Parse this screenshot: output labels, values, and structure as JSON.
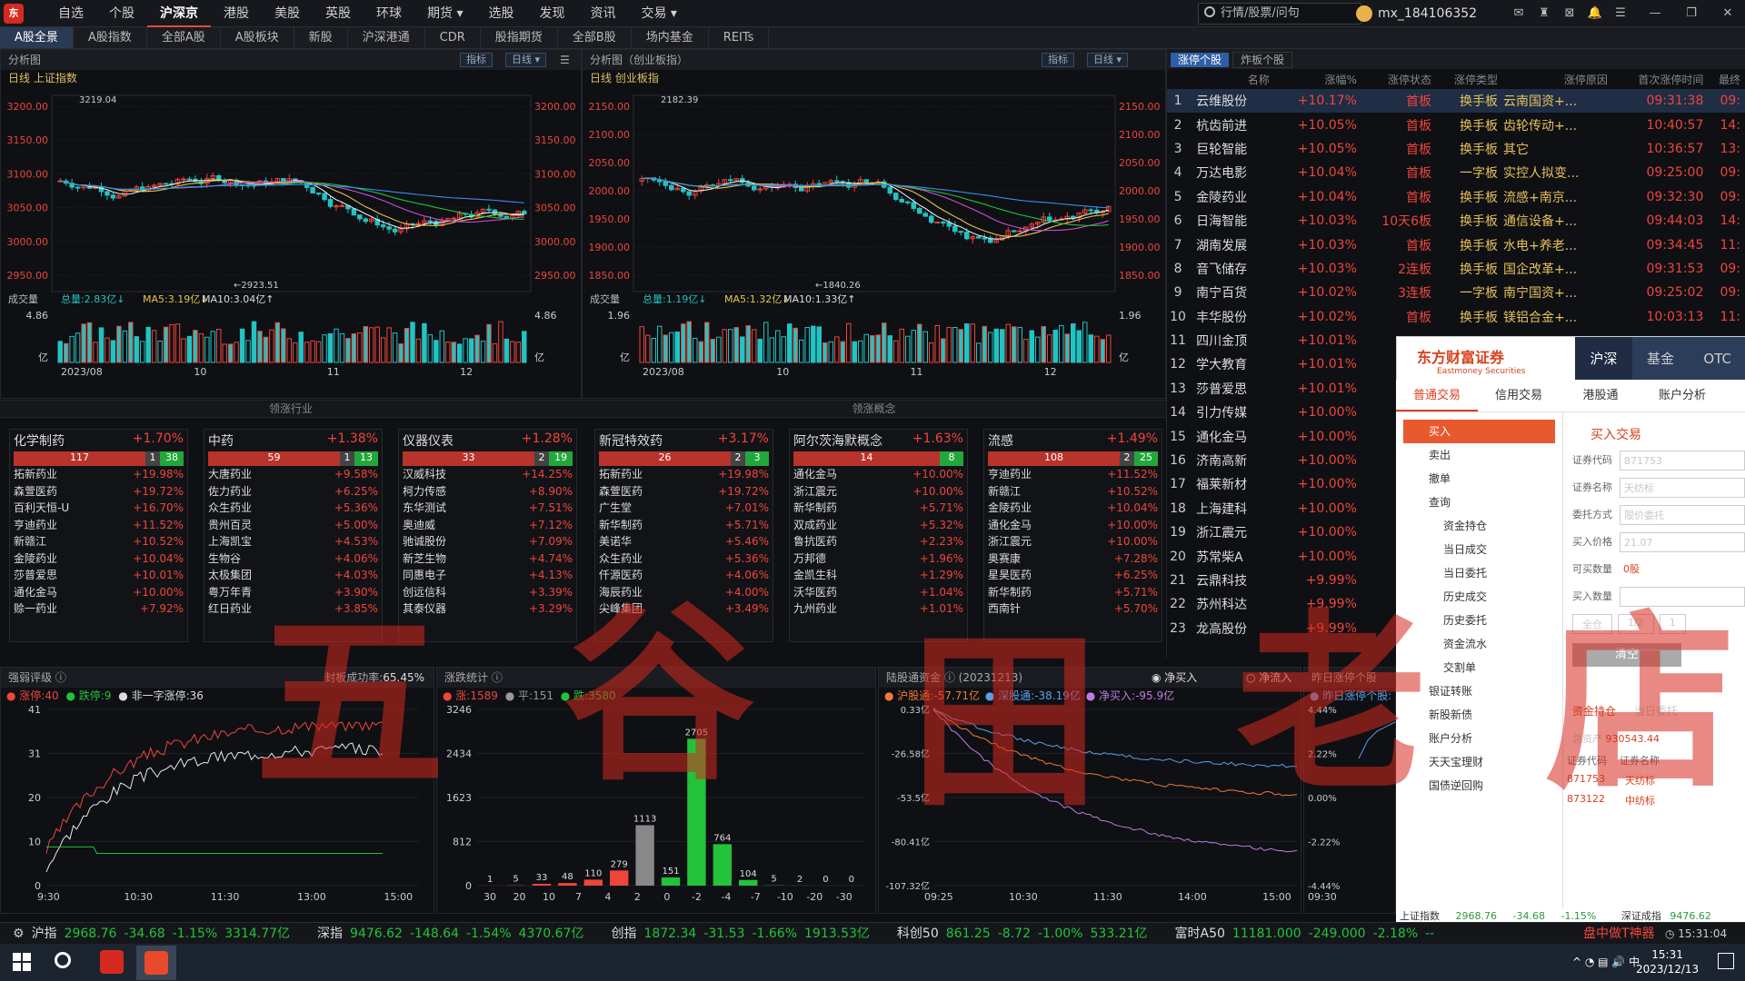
{
  "topnav": [
    "自选",
    "个股",
    "沪深京",
    "港股",
    "美股",
    "英股",
    "环球",
    "期货 ▾",
    "选股",
    "发现",
    "资讯",
    "交易 ▾"
  ],
  "search_placeholder": "行情/股票/问句",
  "user": "mx_184106352",
  "subtabs": [
    "A股全景",
    "A股指数",
    "全部A股",
    "A股板块",
    "新股",
    "沪深港通",
    "CDR",
    "股指期货",
    "全部B股",
    "场内基金",
    "REITs"
  ],
  "chart1": {
    "panel": "分析图",
    "sub": "日线  上证指数",
    "btn1": "指标",
    "btn2": "日线",
    "high": "3219.04",
    "low": "2923.51",
    "yticks": [
      "3200.00",
      "3150.00",
      "3100.00",
      "3050.00",
      "3000.00",
      "2950.00"
    ],
    "vol_label": "成交量",
    "vol_total": "总量:2.83亿",
    "vol_ma5": "MA5:3.19亿",
    "vol_ma10": "MA10:3.04亿",
    "vol_max": "4.86",
    "vol_unit": "亿",
    "xticks": [
      "2023/08",
      "10",
      "11",
      "12"
    ]
  },
  "chart2": {
    "panel": "分析图（创业板指）",
    "sub": "日线  创业板指",
    "btn1": "指标",
    "btn2": "日线",
    "high": "2182.39",
    "low": "1840.26",
    "yticks": [
      "2150.00",
      "2100.00",
      "2050.00",
      "2000.00",
      "1950.00",
      "1900.00",
      "1850.00"
    ],
    "vol_label": "成交量",
    "vol_total": "总量:1.19亿",
    "vol_ma5": "MA5:1.32亿",
    "vol_ma10": "MA10:1.33亿",
    "vol_max": "1.96",
    "vol_unit": "亿",
    "xticks": [
      "2023/08",
      "10",
      "11",
      "12"
    ]
  },
  "sec1_title": "领涨行业",
  "sec2_title": "领涨概念",
  "sectors": [
    {
      "name": "化学制药",
      "pct": "+1.70%",
      "up": "117",
      "flat": "1",
      "down": "38",
      "rows": [
        [
          "拓新药业",
          "+19.98%"
        ],
        [
          "森萱医药",
          "+19.72%"
        ],
        [
          "百利天恒-U",
          "+16.70%"
        ],
        [
          "亨迪药业",
          "+11.52%"
        ],
        [
          "新赣江",
          "+10.52%"
        ],
        [
          "金陵药业",
          "+10.04%"
        ],
        [
          "莎普爱思",
          "+10.01%"
        ],
        [
          "通化金马",
          "+10.00%"
        ],
        [
          "赊一药业",
          "+7.92%"
        ]
      ]
    },
    {
      "name": "中药",
      "pct": "+1.38%",
      "up": "59",
      "flat": "1",
      "down": "13",
      "rows": [
        [
          "大唐药业",
          "+9.58%"
        ],
        [
          "佐力药业",
          "+6.25%"
        ],
        [
          "众生药业",
          "+5.36%"
        ],
        [
          "贵州百灵",
          "+5.00%"
        ],
        [
          "上海凯宝",
          "+4.53%"
        ],
        [
          "生物谷",
          "+4.06%"
        ],
        [
          "太极集团",
          "+4.03%"
        ],
        [
          "粤万年青",
          "+3.90%"
        ],
        [
          "红日药业",
          "+3.85%"
        ]
      ]
    },
    {
      "name": "仪器仪表",
      "pct": "+1.28%",
      "up": "33",
      "flat": "2",
      "down": "19",
      "rows": [
        [
          "汉威科技",
          "+14.25%"
        ],
        [
          "柯力传感",
          "+8.90%"
        ],
        [
          "东华测试",
          "+7.51%"
        ],
        [
          "奥迪威",
          "+7.12%"
        ],
        [
          "驰诚股份",
          "+7.09%"
        ],
        [
          "新芝生物",
          "+4.74%"
        ],
        [
          "同惠电子",
          "+4.13%"
        ],
        [
          "创远信科",
          "+3.39%"
        ],
        [
          "其泰仪器",
          "+3.29%"
        ]
      ]
    },
    {
      "name": "新冠特效药",
      "pct": "+3.17%",
      "up": "26",
      "flat": "2",
      "down": "3",
      "rows": [
        [
          "拓新药业",
          "+19.98%"
        ],
        [
          "森萱医药",
          "+19.72%"
        ],
        [
          "广生堂",
          "+7.01%"
        ],
        [
          "新华制药",
          "+5.71%"
        ],
        [
          "美诺华",
          "+5.46%"
        ],
        [
          "众生药业",
          "+5.36%"
        ],
        [
          "仟源医药",
          "+4.06%"
        ],
        [
          "海辰药业",
          "+4.00%"
        ],
        [
          "尖峰集团",
          "+3.49%"
        ]
      ]
    },
    {
      "name": "阿尔茨海默概念",
      "pct": "+1.63%",
      "up": "14",
      "flat": "",
      "down": "8",
      "rows": [
        [
          "通化金马",
          "+10.00%"
        ],
        [
          "浙江震元",
          "+10.00%"
        ],
        [
          "新华制药",
          "+5.71%"
        ],
        [
          "双成药业",
          "+5.32%"
        ],
        [
          "鲁抗医药",
          "+2.23%"
        ],
        [
          "万邦德",
          "+1.96%"
        ],
        [
          "金凯生科",
          "+1.29%"
        ],
        [
          "沃华医药",
          "+1.04%"
        ],
        [
          "九州药业",
          "+1.01%"
        ]
      ]
    },
    {
      "name": "流感",
      "pct": "+1.49%",
      "up": "108",
      "flat": "2",
      "down": "25",
      "rows": [
        [
          "亨迪药业",
          "+11.52%"
        ],
        [
          "新赣江",
          "+10.52%"
        ],
        [
          "金陵药业",
          "+10.04%"
        ],
        [
          "通化金马",
          "+10.00%"
        ],
        [
          "浙江震元",
          "+10.00%"
        ],
        [
          "奥赛康",
          "+7.28%"
        ],
        [
          "星昊医药",
          "+6.25%"
        ],
        [
          "新华制药",
          "+5.71%"
        ],
        [
          "西南针",
          "+5.70%"
        ]
      ]
    }
  ],
  "limitup": {
    "tabs": [
      "涨停个股",
      "炸板个股"
    ],
    "headers": [
      "",
      "名称",
      "涨幅%",
      "涨停状态",
      "涨停类型",
      "涨停原因",
      "首次涨停时间",
      "最终"
    ],
    "rows": [
      [
        "1",
        "云维股份",
        "+10.17%",
        "首板",
        "换手板",
        "云南国资+...",
        "09:31:38",
        "09:"
      ],
      [
        "2",
        "杭齿前进",
        "+10.05%",
        "首板",
        "换手板",
        "齿轮传动+...",
        "10:40:57",
        "14:"
      ],
      [
        "3",
        "巨轮智能",
        "+10.05%",
        "首板",
        "换手板",
        "其它",
        "10:36:57",
        "13:"
      ],
      [
        "4",
        "万达电影",
        "+10.04%",
        "首板",
        "一字板",
        "实控人拟变...",
        "09:25:00",
        "09:"
      ],
      [
        "5",
        "金陵药业",
        "+10.04%",
        "首板",
        "换手板",
        "流感+南京...",
        "09:32:30",
        "09:"
      ],
      [
        "6",
        "日海智能",
        "+10.03%",
        "10天6板",
        "换手板",
        "通信设备+...",
        "09:44:03",
        "14:"
      ],
      [
        "7",
        "湖南发展",
        "+10.03%",
        "首板",
        "换手板",
        "水电+养老...",
        "09:34:45",
        "11:"
      ],
      [
        "8",
        "音飞储存",
        "+10.03%",
        "2连板",
        "换手板",
        "国企改革+...",
        "09:31:53",
        "09:"
      ],
      [
        "9",
        "南宁百货",
        "+10.02%",
        "3连板",
        "一字板",
        "南宁国资+...",
        "09:25:02",
        "09:"
      ],
      [
        "10",
        "丰华股份",
        "+10.02%",
        "首板",
        "换手板",
        "镁铝合金+...",
        "10:03:13",
        "11:"
      ],
      [
        "11",
        "四川金顶",
        "+10.01%",
        "",
        "",
        "",
        "",
        ""
      ],
      [
        "12",
        "学大教育",
        "+10.01%",
        "",
        "",
        "",
        "",
        ""
      ],
      [
        "13",
        "莎普爱思",
        "+10.01%",
        "",
        "",
        "",
        "",
        ""
      ],
      [
        "14",
        "引力传媒",
        "+10.00%",
        "",
        "",
        "",
        "",
        ""
      ],
      [
        "15",
        "通化金马",
        "+10.00%",
        "",
        "",
        "",
        "",
        ""
      ],
      [
        "16",
        "济南高新",
        "+10.00%",
        "",
        "",
        "",
        "",
        ""
      ],
      [
        "17",
        "福莱新材",
        "+10.00%",
        "",
        "",
        "",
        "",
        ""
      ],
      [
        "18",
        "上海建科",
        "+10.00%",
        "",
        "",
        "",
        "",
        ""
      ],
      [
        "19",
        "浙江震元",
        "+10.00%",
        "",
        "",
        "",
        "",
        ""
      ],
      [
        "20",
        "苏常柴A",
        "+10.00%",
        "",
        "",
        "",
        "",
        ""
      ],
      [
        "21",
        "云鼎科技",
        "+9.99%",
        "",
        "",
        "",
        "",
        ""
      ],
      [
        "22",
        "苏州科达",
        "+9.99%",
        "",
        "",
        "",
        "",
        ""
      ],
      [
        "23",
        "龙高股份",
        "+9.99%",
        "",
        "",
        "",
        "",
        ""
      ]
    ]
  },
  "trade": {
    "brand": "东方财富证券",
    "brand_en": "Eastmoney Securities",
    "mtabs": [
      "沪深",
      "基金",
      "OTC"
    ],
    "ttabs": [
      "普通交易",
      "信用交易",
      "港股通",
      "账户分析"
    ],
    "menu": [
      "买入",
      "卖出",
      "撤单",
      "查询",
      "资金持仓",
      "当日成交",
      "当日委托",
      "历史成交",
      "历史委托",
      "资金流水",
      "交割单",
      "银证转账",
      "新股新债",
      "账户分析",
      "天天宝理财",
      "国债逆回购"
    ],
    "form_title": "买入交易",
    "code_label": "证券代码",
    "code": "871753",
    "name_label": "证券名称",
    "name": "天纺标",
    "mode_label": "委托方式",
    "mode": "限价委托",
    "price_label": "买入价格",
    "price": "21.07",
    "avail_label": "可买数量",
    "avail": "0股",
    "qty_label": "买入数量",
    "qty_btns": [
      "全仓",
      "1/2",
      "1"
    ],
    "clear": "清空",
    "btabs": [
      "资金持仓",
      "当日委托"
    ],
    "asset_label": "总资产",
    "asset": "930543.44",
    "cols": [
      "证券代码",
      "证券名称"
    ],
    "pos": [
      [
        "871753",
        "天纺标"
      ],
      [
        "873122",
        "中纺标"
      ]
    ],
    "foot": [
      [
        "上证指数",
        "2968.76",
        "-34.68",
        "-1.15%"
      ],
      [
        "深证成指",
        "9476.62"
      ]
    ]
  },
  "strength": {
    "title": "强弱评级",
    "rate_label": "封板成功率:",
    "rate": "65.45%",
    "zt_label": "涨停:",
    "zt": "40",
    "dt_label": "跌停:",
    "dt": "9",
    "fz_label": "非一字涨停:",
    "fz": "36",
    "yticks": [
      "41",
      "31",
      "20",
      "10",
      "0"
    ],
    "xticks": [
      "9:30",
      "10:30",
      "11:30",
      "13:00",
      "15:00"
    ]
  },
  "updown": {
    "title": "涨跌统计",
    "up_label": "涨:",
    "up": "1589",
    "flat_label": "平:",
    "flat": "151",
    "down_label": "跌:",
    "down": "3580",
    "yticks": [
      "3246",
      "2434",
      "1623",
      "812",
      "0"
    ],
    "bins": [
      "30",
      "20",
      "10",
      "7",
      "4",
      "2",
      "0",
      "-2",
      "-4",
      "-7",
      "-10",
      "-20",
      "-30"
    ]
  },
  "chart_data": [
    {
      "type": "bar",
      "title": "涨跌统计",
      "categories": [
        "30",
        "20",
        "10",
        "7",
        "4",
        "2",
        "0",
        "-2",
        "-4",
        "-7",
        "-10",
        "-20",
        "-30"
      ],
      "values": [
        1,
        5,
        33,
        48,
        110,
        279,
        1113,
        151,
        2705,
        764,
        104,
        5,
        2,
        0,
        0
      ],
      "labels": [
        "1",
        "5",
        "33",
        "48",
        "110",
        "279",
        "1113",
        "151",
        "2705",
        "764",
        "104",
        "5",
        "2",
        "0",
        "0"
      ]
    }
  ],
  "hsgt": {
    "title": "陆股通资金",
    "date": "(20231213)",
    "net_buy": "净买入",
    "net_flow": "净流入",
    "sh_label": "沪股通:",
    "sh": "-57.71亿",
    "sz_label": "深股通:",
    "sz": "-38.19亿",
    "nb_label": "净买入:",
    "nb": "-95.9亿",
    "yticks": [
      "0.33亿",
      "-26.58亿",
      "-53.5亿",
      "-80.41亿",
      "-107.32亿"
    ],
    "xticks": [
      "09:25",
      "10:30",
      "11:30",
      "14:00",
      "15:00"
    ]
  },
  "yest": {
    "title": "昨日涨停个股",
    "legend": "昨日涨停个股:",
    "yticks": [
      "4.44%",
      "2.22%",
      "0.00%",
      "-2.22%",
      "-4.44%"
    ],
    "xticks": [
      "09:30"
    ]
  },
  "status": [
    [
      "沪指",
      "2968.76",
      "-34.68",
      "-1.15%",
      "3314.77亿"
    ],
    [
      "深指",
      "9476.62",
      "-148.64",
      "-1.54%",
      "4370.67亿"
    ],
    [
      "创指",
      "1872.34",
      "-31.53",
      "-1.66%",
      "1913.53亿"
    ],
    [
      "科创50",
      "861.25",
      "-8.72",
      "-1.00%",
      "533.21亿"
    ],
    [
      "富时A50",
      "11181.000",
      "-249.000",
      "-2.18%",
      "--"
    ]
  ],
  "status_right": "盘中做T神器",
  "clock_small": "15:31:04",
  "tray": {
    "time": "15:31",
    "date": "2023/12/13",
    "ime": "中"
  },
  "watermark": [
    "五",
    "谷",
    "田",
    "老",
    "店"
  ]
}
